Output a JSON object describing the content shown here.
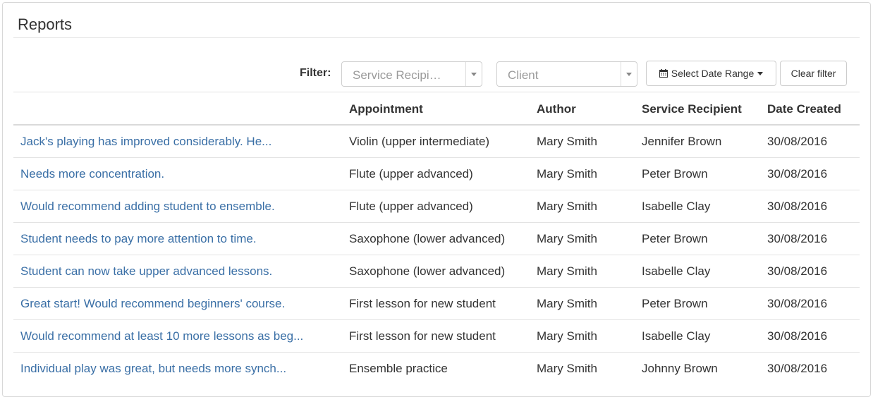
{
  "page": {
    "title": "Reports"
  },
  "filter": {
    "label": "Filter:",
    "service_recipient_placeholder": "Service Recipi…",
    "client_placeholder": "Client",
    "date_range_label": "Select Date Range",
    "clear_label": "Clear filter"
  },
  "table": {
    "columns": [
      "",
      "Appointment",
      "Author",
      "Service Recipient",
      "Date Created"
    ],
    "rows": [
      {
        "report": "Jack's playing has improved considerably. He...",
        "appointment": "Violin (upper intermediate)",
        "author": "Mary Smith",
        "recipient": "Jennifer Brown",
        "date": "30/08/2016"
      },
      {
        "report": "Needs more concentration.",
        "appointment": "Flute (upper advanced)",
        "author": "Mary Smith",
        "recipient": "Peter Brown",
        "date": "30/08/2016"
      },
      {
        "report": "Would recommend adding student to ensemble.",
        "appointment": "Flute (upper advanced)",
        "author": "Mary Smith",
        "recipient": "Isabelle Clay",
        "date": "30/08/2016"
      },
      {
        "report": "Student needs to pay more attention to time.",
        "appointment": "Saxophone (lower advanced)",
        "author": "Mary Smith",
        "recipient": "Peter Brown",
        "date": "30/08/2016"
      },
      {
        "report": "Student can now take upper advanced lessons.",
        "appointment": "Saxophone (lower advanced)",
        "author": "Mary Smith",
        "recipient": "Isabelle Clay",
        "date": "30/08/2016"
      },
      {
        "report": "Great start! Would recommend beginners' course.",
        "appointment": "First lesson for new student",
        "author": "Mary Smith",
        "recipient": "Peter Brown",
        "date": "30/08/2016"
      },
      {
        "report": "Would recommend at least 10 more lessons as beg...",
        "appointment": "First lesson for new student",
        "author": "Mary Smith",
        "recipient": "Isabelle Clay",
        "date": "30/08/2016"
      },
      {
        "report": "Individual play was great, but needs more synch...",
        "appointment": "Ensemble practice",
        "author": "Mary Smith",
        "recipient": "Johnny Brown",
        "date": "30/08/2016"
      }
    ]
  },
  "colors": {
    "link": "#3a6fa6",
    "text": "#333333",
    "border": "#e3e3e3"
  }
}
